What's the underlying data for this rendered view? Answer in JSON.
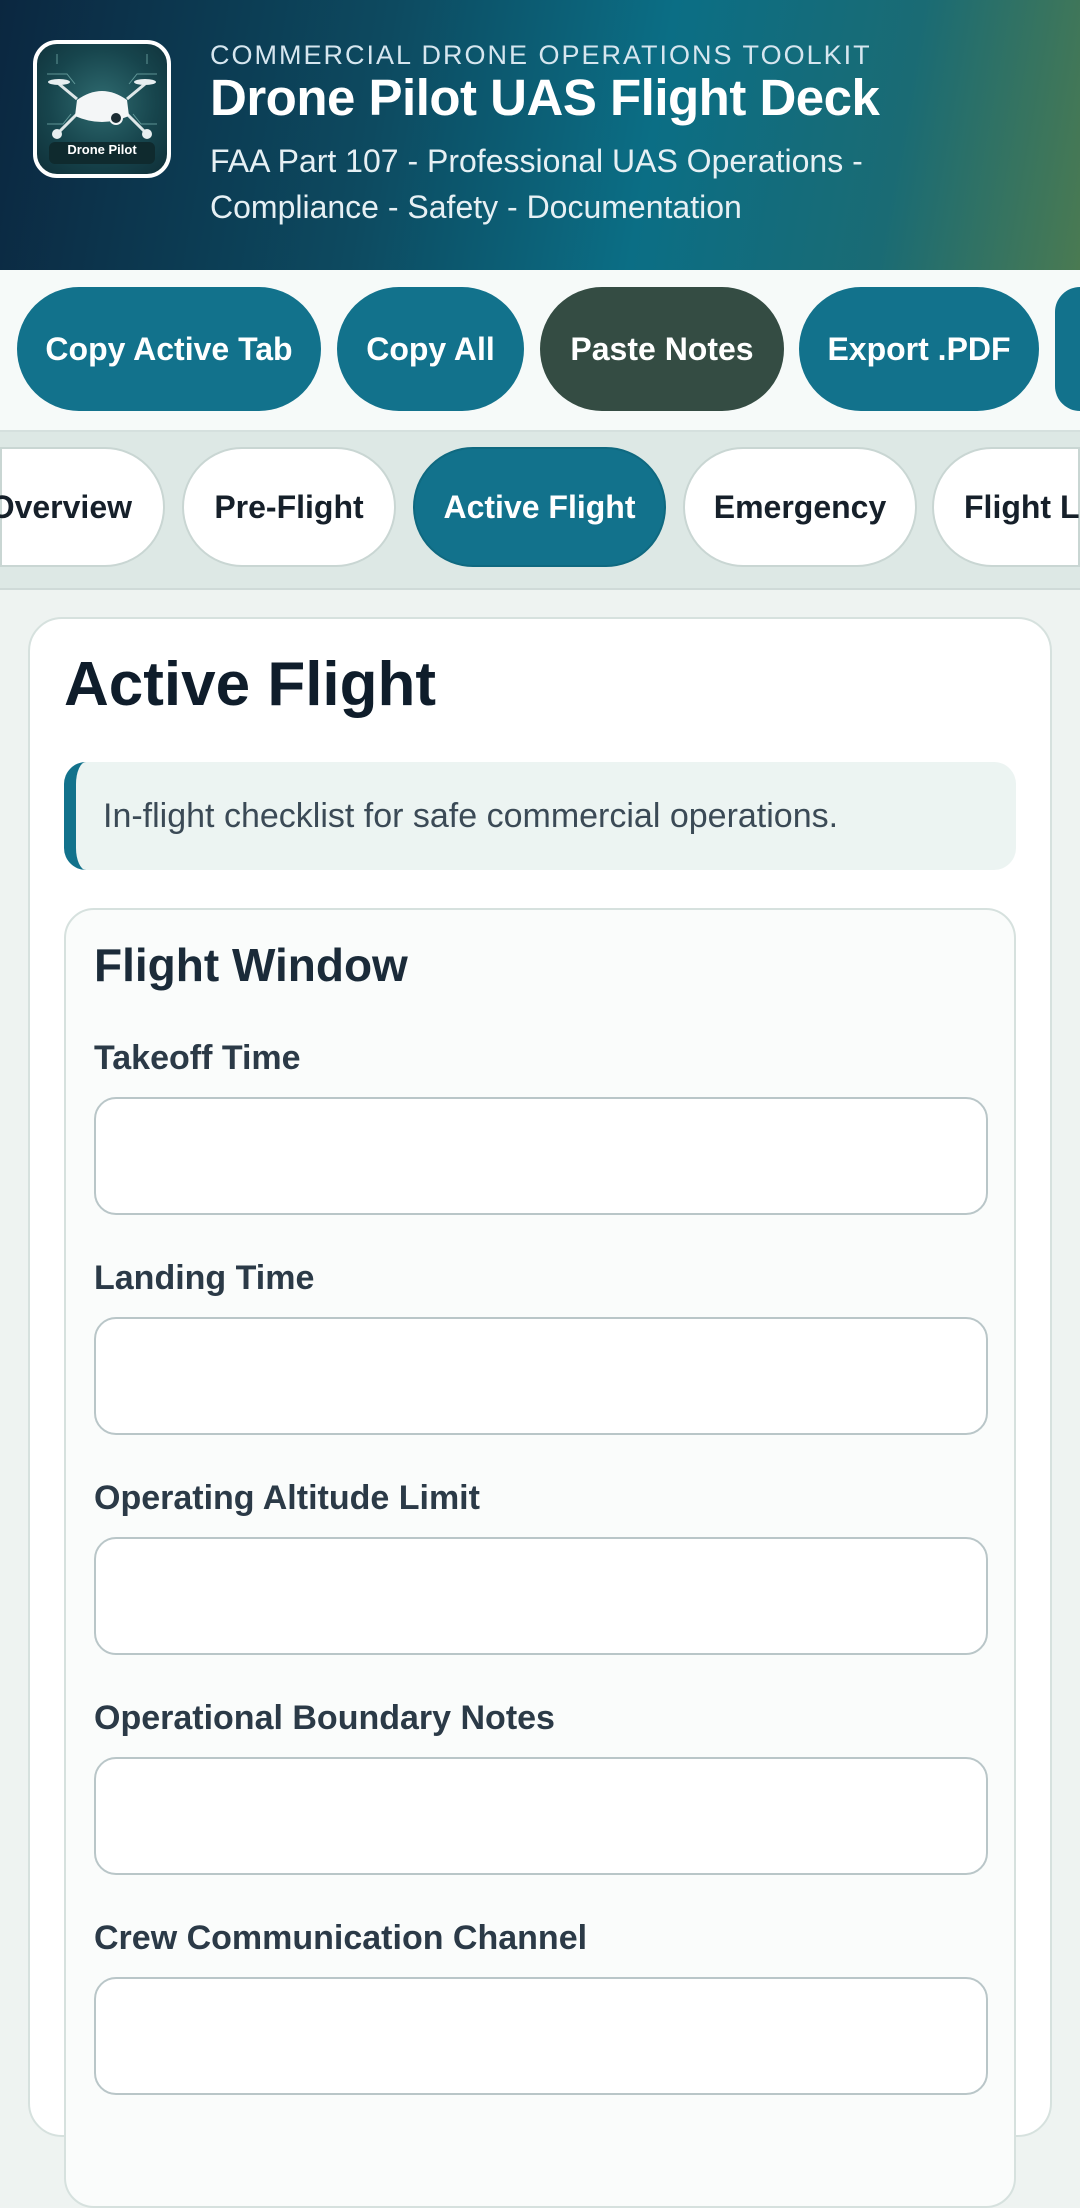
{
  "header": {
    "kicker": "COMMERCIAL DRONE OPERATIONS TOOLKIT",
    "title": "Drone Pilot UAS Flight Deck",
    "subtitle": "FAA Part 107 - Professional UAS Operations - Compliance - Safety - Documentation",
    "logo_text": "Drone Pilot"
  },
  "toolbar": {
    "copy_active_tab": "Copy Active Tab",
    "copy_all": "Copy All",
    "paste_notes": "Paste Notes",
    "export_pdf": "Export .PDF"
  },
  "tabs": [
    {
      "label": "Overview",
      "active": false
    },
    {
      "label": "Pre-Flight",
      "active": false
    },
    {
      "label": "Active Flight",
      "active": true
    },
    {
      "label": "Emergency",
      "active": false
    },
    {
      "label": "Flight Log",
      "active": false
    }
  ],
  "main": {
    "title": "Active Flight",
    "intro": "In-flight checklist for safe commercial operations.",
    "section": {
      "title": "Flight Window",
      "fields": [
        {
          "label": "Takeoff Time",
          "value": ""
        },
        {
          "label": "Landing Time",
          "value": ""
        },
        {
          "label": "Operating Altitude Limit",
          "value": ""
        },
        {
          "label": "Operational Boundary Notes",
          "value": ""
        },
        {
          "label": "Crew Communication Channel",
          "value": ""
        }
      ]
    }
  },
  "colors": {
    "accent": "#12728c",
    "paste_button": "#344c43",
    "header_dark": "#0b2740"
  }
}
